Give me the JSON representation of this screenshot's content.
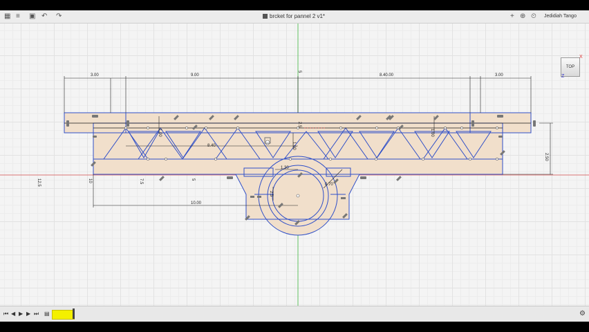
{
  "window": {
    "document_title": "brcket for pannel 2 v1*",
    "user_name": "Jedidiah Tango"
  },
  "viewcube": {
    "face_label": "TOP",
    "x_axis": "X",
    "z_axis": "Z"
  },
  "toolbar": {
    "icons": [
      "grid-icon",
      "menu-icon",
      "save-icon",
      "undo-icon",
      "redo-icon"
    ]
  },
  "dimensions": {
    "d1": "3.00",
    "d2": "9.00",
    "d3": "8.40.00",
    "d4": "3.00",
    "d5": "1.00",
    "d6": "8.40",
    "d7": "2.50",
    "d8": "10.00",
    "d9": "1.30",
    "d10": "0.70",
    "d11": "1.00",
    "d12": "2.5",
    "d13": "5",
    "d14": "7.5",
    "d15": "10",
    "d16": "12.5",
    "d17": "5",
    "d18": "2.5",
    "d19": "1.00"
  },
  "timeline": {
    "controls": [
      "first",
      "previous",
      "play",
      "next",
      "last"
    ]
  },
  "colors": {
    "sketch_line": "#2f4fc8",
    "profile_fill": "#f1dfcb",
    "constraint_icon": "#707070",
    "axis_red": "#d24b4b",
    "axis_green": "#3cb43c",
    "timeline_feature": "#f4f000"
  }
}
